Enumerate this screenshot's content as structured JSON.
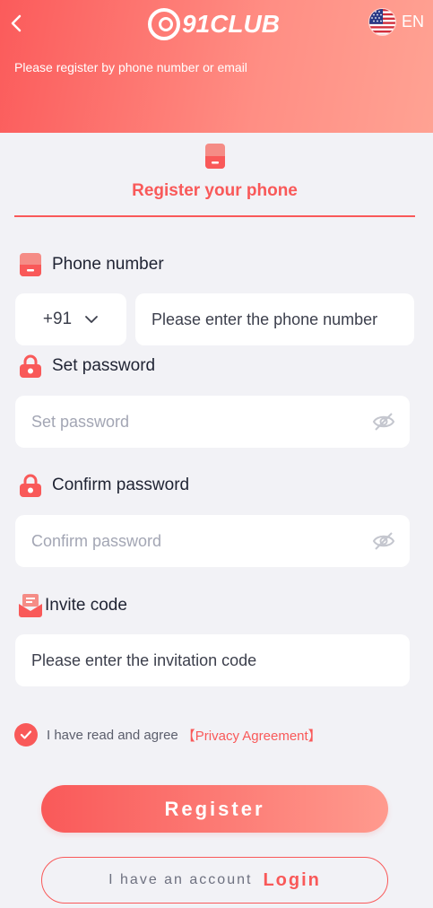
{
  "header": {
    "logo_text": "91CLUB",
    "language": "EN",
    "subtitle": "Please register by phone number or email"
  },
  "tab": {
    "label": "Register your phone"
  },
  "phone": {
    "label": "Phone number",
    "country_code": "+91",
    "placeholder": "Please enter the phone number"
  },
  "password": {
    "label": "Set password",
    "placeholder": "Set password"
  },
  "confirm": {
    "label": "Confirm password",
    "placeholder": "Confirm password"
  },
  "invite": {
    "label": "Invite code",
    "placeholder": "Please enter the invitation code"
  },
  "agreement": {
    "text": "I have read and agree",
    "link": "【Privacy Agreement】",
    "checked": true
  },
  "buttons": {
    "register": "Register",
    "have_account": "I have an account",
    "login": "Login"
  },
  "colors": {
    "accent": "#f95959",
    "header_start": "#fb5b5b",
    "header_end": "#ffa293",
    "background": "#f2f2f6"
  },
  "icons": {
    "back": "chevron-left-icon",
    "flag": "us-flag-icon",
    "phone": "phone-icon",
    "lock": "lock-icon",
    "invite": "invite-icon",
    "eye": "eye-off-icon",
    "check": "check-icon",
    "chevron": "chevron-down-icon"
  }
}
